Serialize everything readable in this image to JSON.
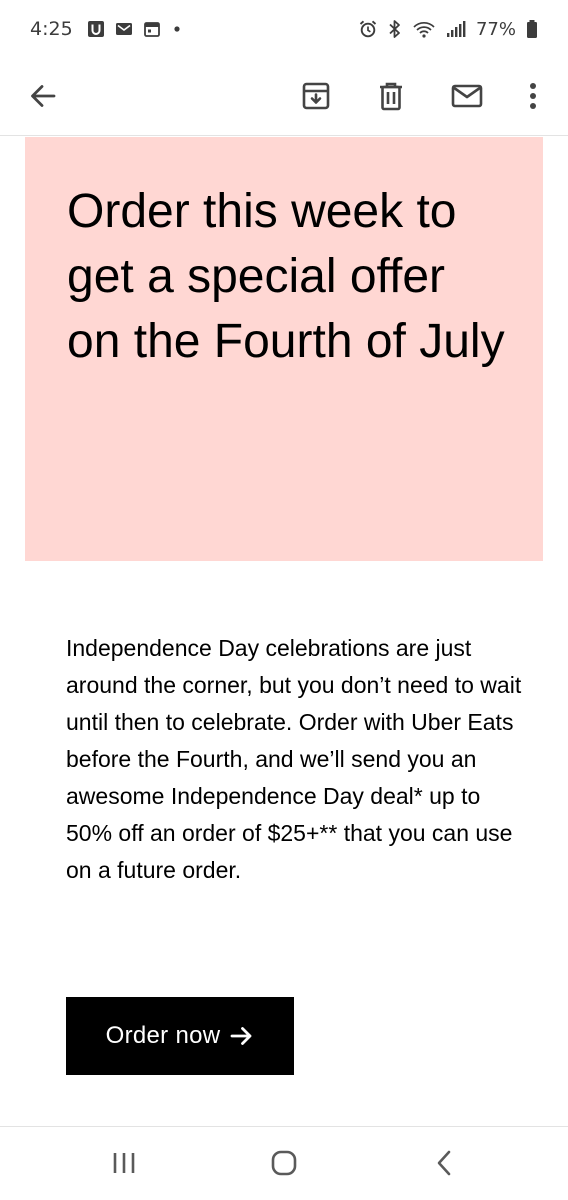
{
  "status_bar": {
    "time": "4:25",
    "battery": "77%",
    "left_icons": [
      "u-app-icon",
      "gmail-icon",
      "calendar-icon",
      "dot-icon"
    ],
    "right_icons": [
      "alarm-icon",
      "bluetooth-icon",
      "wifi-icon",
      "signal-icon",
      "battery-icon"
    ]
  },
  "toolbar": {
    "icons": [
      "back-arrow-icon",
      "archive-icon",
      "delete-icon",
      "mail-icon",
      "more-vert-icon"
    ]
  },
  "hero": {
    "title": "Order this week to get a special offer on the Fourth of July",
    "background": "#ffd7d3"
  },
  "body": {
    "text": "Independence Day celebrations are just around the corner, but you don’t need to wait until then to celebrate. Order with Uber Eats before the Fourth, and we’ll send you an awesome Independence Day deal* up to 50% off an order of $25+** that you can use on a future order."
  },
  "cta": {
    "label": "Order now",
    "icon": "arrow-right-icon",
    "background": "#000000"
  },
  "nav_bar": {
    "icons": [
      "recents-icon",
      "home-icon",
      "back-icon"
    ]
  }
}
